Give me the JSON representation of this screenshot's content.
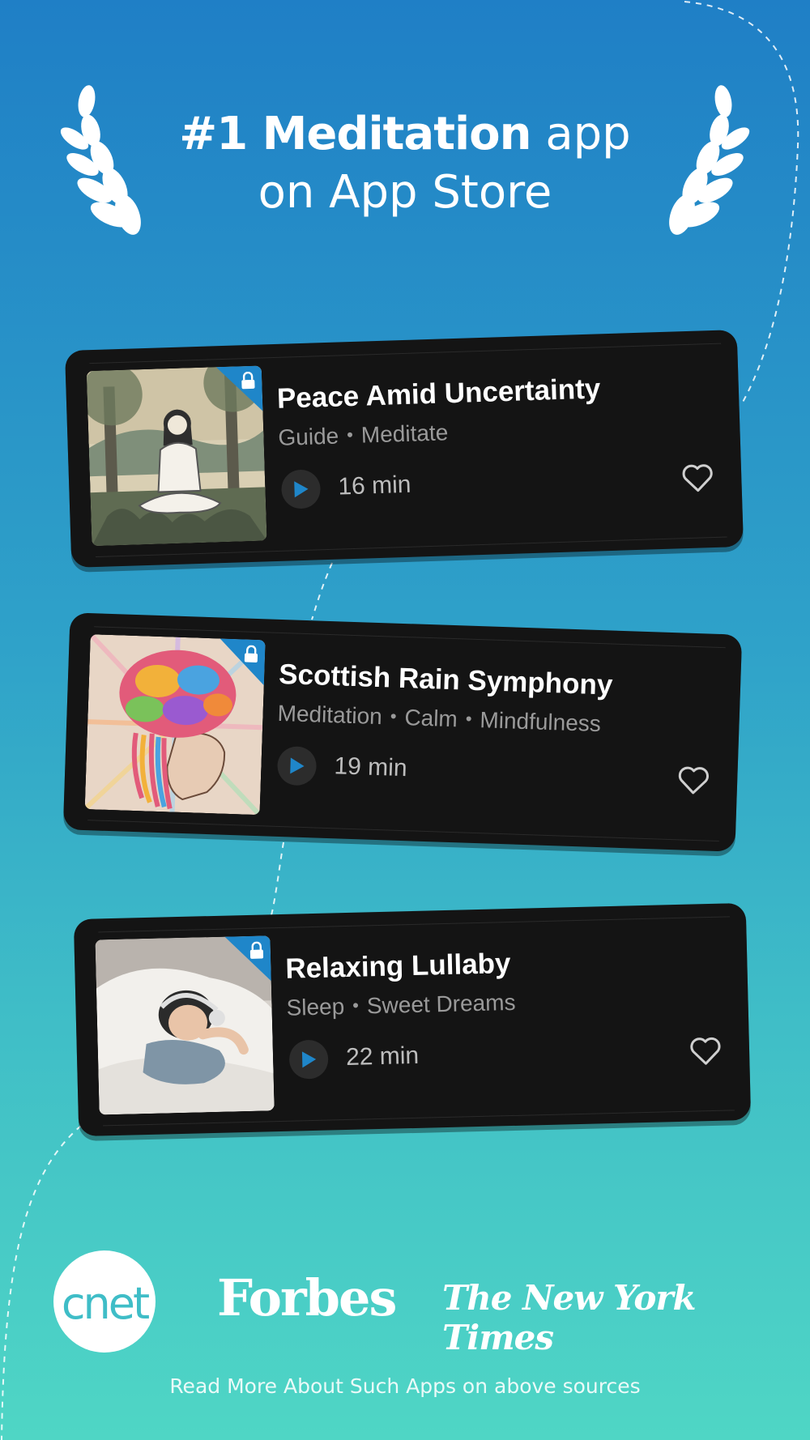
{
  "header": {
    "headline_bold": "#1 Meditation",
    "headline_light": "app",
    "headline_line2": "on App Store"
  },
  "cards": [
    {
      "title": "Peace Amid Uncertainty",
      "tags": [
        "Guide",
        "Meditate"
      ],
      "duration": "16 min",
      "locked": true,
      "thumbnail": "meditating-woman-illustration"
    },
    {
      "title": "Scottish Rain Symphony",
      "tags": [
        "Meditation",
        "Calm",
        "Mindfulness"
      ],
      "duration": "19 min",
      "locked": true,
      "thumbnail": "colorful-brain-head-illustration"
    },
    {
      "title": "Relaxing Lullaby",
      "tags": [
        "Sleep",
        "Sweet Dreams"
      ],
      "duration": "22 min",
      "locked": true,
      "thumbnail": "sleeping-girl-headphones-illustration"
    }
  ],
  "press": {
    "logos": [
      "cnet",
      "Forbes",
      "The New York Times"
    ],
    "note": "Read More About Such Apps on above sources"
  },
  "colors": {
    "accent": "#1f86c9",
    "card_bg": "#141414",
    "bg_top": "#1f7fc6",
    "bg_bottom": "#4fd6c5"
  }
}
